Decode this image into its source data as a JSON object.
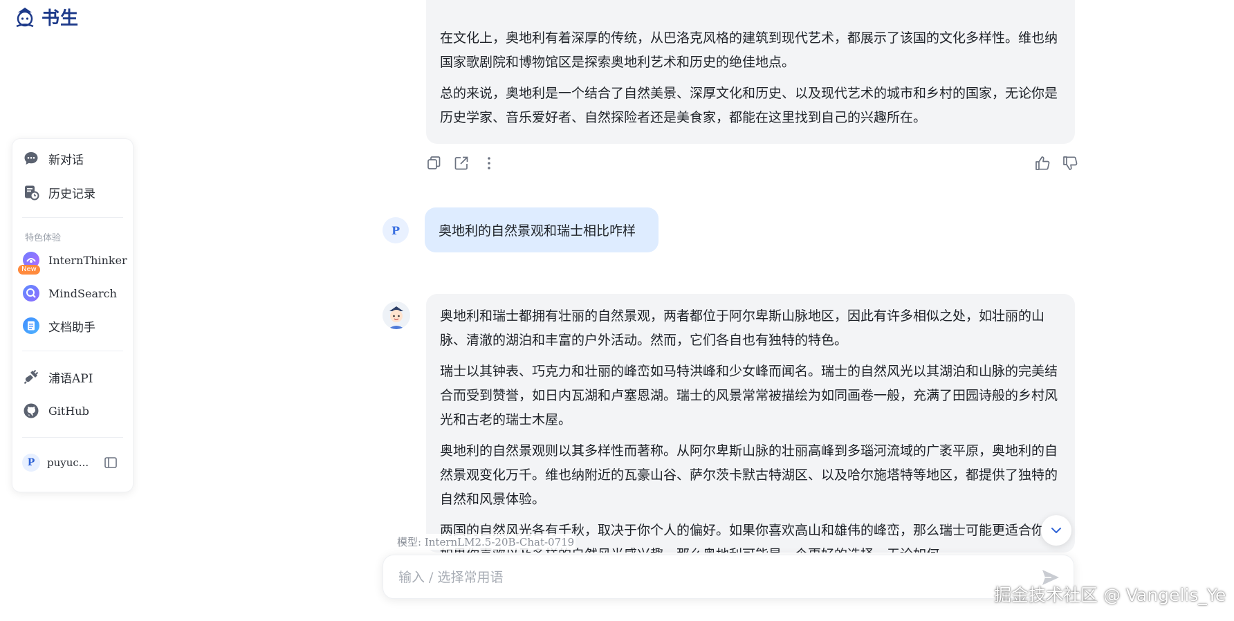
{
  "logo": {
    "text": "书生"
  },
  "sidebar": {
    "new_chat": "新对话",
    "history": "历史记录",
    "section_label": "特色体验",
    "features": [
      {
        "label": "InternThinker",
        "badge": "New"
      },
      {
        "label": "MindSearch"
      },
      {
        "label": "文档助手"
      }
    ],
    "links": [
      {
        "label": "浦语API"
      },
      {
        "label": "GitHub"
      }
    ],
    "user": {
      "initial": "P",
      "name": "puyuc..."
    }
  },
  "chat": {
    "prev_answer_paragraphs": [
      "在文化上，奥地利有着深厚的传统，从巴洛克风格的建筑到现代艺术，都展示了该国的文化多样性。维也纳国家歌剧院和博物馆区是探索奥地利艺术和历史的绝佳地点。",
      "总的来说，奥地利是一个结合了自然美景、深厚文化和历史、以及现代艺术的城市和乡村的国家，无论你是历史学家、音乐爱好者、自然探险者还是美食家，都能在这里找到自己的兴趣所在。"
    ],
    "user_initial": "P",
    "user_message": "奥地利的自然景观和瑞士相比咋样",
    "answer_paragraphs": [
      "奥地利和瑞士都拥有壮丽的自然景观，两者都位于阿尔卑斯山脉地区，因此有许多相似之处，如壮丽的山脉、清澈的湖泊和丰富的户外活动。然而，它们各自也有独特的特色。",
      "瑞士以其钟表、巧克力和壮丽的峰峦如马特洪峰和少女峰而闻名。瑞士的自然风光以其湖泊和山脉的完美结合而受到赞誉，如日内瓦湖和卢塞恩湖。瑞士的风景常常被描绘为如同画卷一般，充满了田园诗般的乡村风光和古老的瑞士木屋。",
      "奥地利的自然景观则以其多样性而著称。从阿尔卑斯山脉的壮丽高峰到多瑙河流域的广袤平原，奥地利的自然景观变化万千。维也纳附近的瓦豪山谷、萨尔茨卡默古特湖区、以及哈尔施塔特等地区，都提供了独特的自然和风景体验。",
      "两国的自然风光各有千秋，取决于你个人的偏好。如果你喜欢高山和雄伟的峰峦，那么瑞士可能更适合你；如果你喜欢以及多样的自然风光感兴趣，那么奥地利可能是一个更好的选择。无论如何"
    ]
  },
  "model_label": {
    "prefix": "模型:",
    "name": "InternLM2.5-20B-Chat-0719"
  },
  "input": {
    "placeholder": "输入 / 选择常用语"
  },
  "watermark": "掘金技术社区 @ Vangelis_Ye",
  "colors": {
    "accent": "#3064d6",
    "user_bubble": "#deecff",
    "assistant_bubble": "#f3f4f6"
  }
}
